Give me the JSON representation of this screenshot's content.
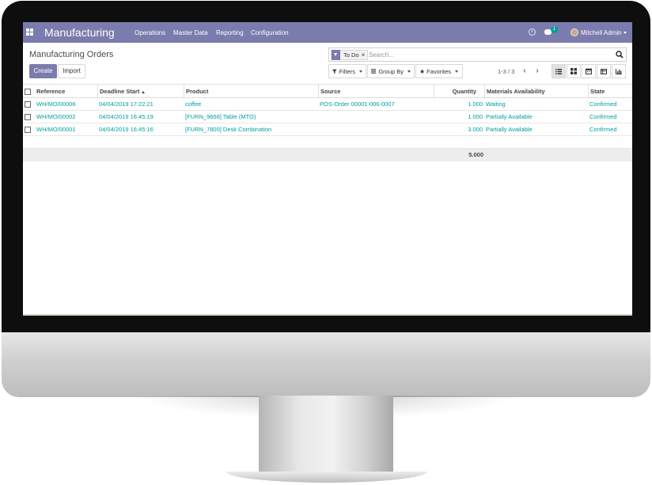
{
  "app": {
    "brand": "Manufacturing",
    "menu": [
      "Operations",
      "Master Data",
      "Reporting",
      "Configuration"
    ],
    "chat_badge": "1",
    "user_name": "Mitchell Admin"
  },
  "control_panel": {
    "title": "Manufacturing Orders",
    "create_label": "Create",
    "import_label": "Import",
    "facet_label": "To Do",
    "facet_remove": "×",
    "search_placeholder": "Search...",
    "filters_label": "Filters",
    "group_by_label": "Group By",
    "favorites_label": "Favorites",
    "pager": "1-3 / 3",
    "pager_prev": "‹",
    "pager_next": "›",
    "views": [
      "list-icon",
      "kanban-icon",
      "calendar-icon",
      "pivot-icon",
      "graph-icon"
    ],
    "active_view": "list"
  },
  "table": {
    "columns": [
      "Reference",
      "Deadline Start",
      "Product",
      "Source",
      "Quantity",
      "Materials Availability",
      "State"
    ],
    "sorted_column": "Deadline Start",
    "sort_direction": "ascending",
    "rows": [
      {
        "reference": "WH/MO/00006",
        "deadline": "04/04/2019 17:22:21",
        "product": "coffee",
        "source": "POS-Order 00001-006-0007",
        "quantity": "1.000",
        "availability": "Waiting",
        "state": "Confirmed"
      },
      {
        "reference": "WH/MO/00002",
        "deadline": "04/04/2019 16:45:19",
        "product": "[FURN_9666] Table (MTO)",
        "source": "",
        "quantity": "1.000",
        "availability": "Partially Available",
        "state": "Confirmed"
      },
      {
        "reference": "WH/MO/00001",
        "deadline": "04/04/2019 16:45:16",
        "product": "[FURN_7800] Desk Combination",
        "source": "",
        "quantity": "3.000",
        "availability": "Partially Available",
        "state": "Confirmed"
      }
    ],
    "total_quantity": "5.000"
  },
  "colors": {
    "brand": "#7c7bad",
    "link": "#00a09d",
    "badge": "#00a09d"
  }
}
